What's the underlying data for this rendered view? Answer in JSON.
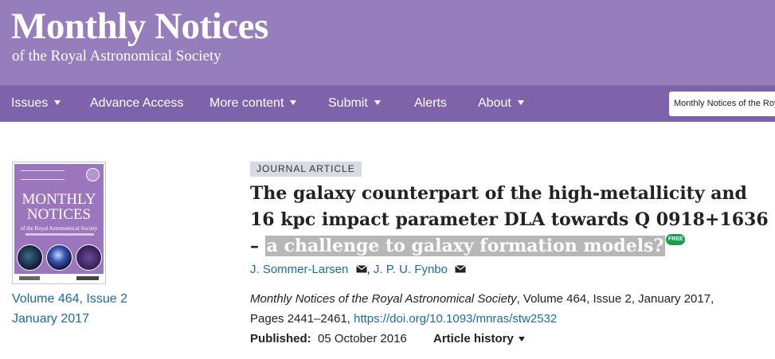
{
  "brand": {
    "title": "Monthly Notices",
    "subtitle": "of the Royal Astronomical Society"
  },
  "nav": {
    "items": [
      {
        "label": "Issues",
        "dropdown": true
      },
      {
        "label": "Advance Access",
        "dropdown": false
      },
      {
        "label": "More content",
        "dropdown": true
      },
      {
        "label": "Submit",
        "dropdown": true
      },
      {
        "label": "Alerts",
        "dropdown": false
      },
      {
        "label": "About",
        "dropdown": true
      }
    ],
    "journal_select_value": "Monthly Notices of the Royal Astronomical Society"
  },
  "cover": {
    "title_line1": "MONTHLY",
    "title_line2": "NOTICES",
    "subtitle": "of the Royal Astronomical Society"
  },
  "issue": {
    "volume_issue": "Volume 464, Issue 2",
    "date": "January 2017"
  },
  "article": {
    "tag": "JOURNAL ARTICLE",
    "title_line1": "The galaxy counterpart of the high-metallicity and",
    "title_line2": "16 kpc impact parameter DLA towards Q 0918+1636",
    "title_line3_prefix": "– ",
    "title_line3_highlight": "a challenge to galaxy formation models?",
    "free_badge": "FREE",
    "authors": [
      "J. Sommer-Larsen",
      "J. P. U. Fynbo"
    ],
    "author_separator": ",",
    "citation_journal": "Monthly Notices of the Royal Astronomical Society",
    "citation_rest": ", Volume 464, Issue 2, January 2017,",
    "citation_pages": "Pages 2441–2461, ",
    "doi": "https://doi.org/10.1093/mnras/stw2532",
    "published_label": "Published:",
    "published_date": "05 October 2016",
    "history_label": "Article history"
  },
  "colors": {
    "masthead": "#967ebd",
    "navbar": "#7e63ab",
    "link": "#1a6bad",
    "free_badge": "#1a9e4b"
  },
  "icons": [
    "envelope-icon",
    "caret-down-icon"
  ]
}
